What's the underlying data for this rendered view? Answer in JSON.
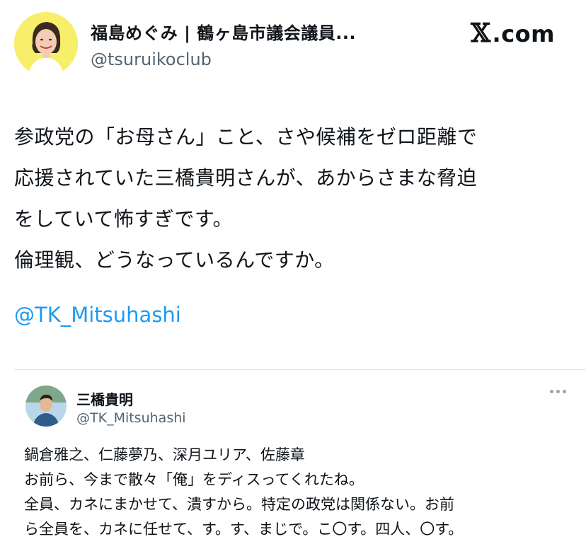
{
  "author": {
    "name": "福島めぐみ | 鶴ヶ島市議会議員...",
    "handle": "@tsuruikoclub"
  },
  "brand": {
    "x_glyph": "𝕏",
    "label": ".com"
  },
  "tweet": {
    "lines": [
      "参政党の「お母さん」こと、さや候補をゼロ距離で",
      "応援されていた三橋貴明さんが、あからさまな脅迫",
      "をしていて怖すぎです。",
      "倫理観、どうなっているんですか。"
    ],
    "mention": "@TK_Mitsuhashi"
  },
  "quoted": {
    "name": "三橋貴明",
    "handle": "@TK_Mitsuhashi",
    "lines": [
      "鍋倉雅之、仁藤夢乃、深月ユリア、佐藤章",
      "お前ら、今まで散々「俺」をディスってくれたね。",
      "全員、カネにまかせて、潰すから。特定の政党は関係ない。お前",
      "ら全員を、カネに任せて、す。す、まじで。こ〇す。四人、〇す。"
    ]
  },
  "colors": {
    "link": "#1d9bf0",
    "secondary_text": "#536471",
    "avatar_bg": "#f7ef6a"
  },
  "icons": [
    "avatar",
    "quoted-avatar",
    "more-icon",
    "x-logo"
  ]
}
